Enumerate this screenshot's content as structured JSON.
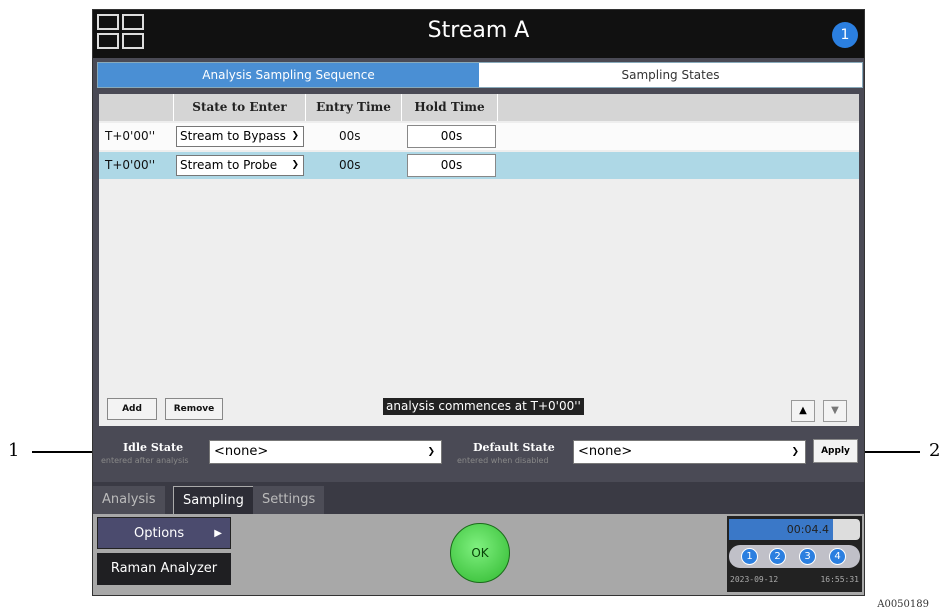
{
  "window": {
    "title": "Stream A",
    "notification_count": "1"
  },
  "top_tabs": [
    "Analysis Sampling Sequence",
    "Sampling States"
  ],
  "table": {
    "headers": [
      "",
      "State to Enter",
      "Entry Time",
      "Hold Time"
    ],
    "rows": [
      {
        "time": "T+0'00''",
        "state": "Stream to Bypass",
        "entry": "00s",
        "hold": "00s"
      },
      {
        "time": "T+0'00''",
        "state": "Stream to Probe",
        "entry": "00s",
        "hold": "00s"
      }
    ]
  },
  "buttons": {
    "add": "Add",
    "remove": "Remove",
    "apply": "Apply",
    "up_arrow": "▲",
    "down_arrow": "▼"
  },
  "commence_text": "analysis commences at T+0'00''",
  "idle": {
    "label": "Idle State",
    "sub": "entered after analysis",
    "value": "<none>"
  },
  "default": {
    "label": "Default State",
    "sub": "entered when disabled",
    "value": "<none>"
  },
  "bottom_tabs": [
    "Analysis",
    "Sampling",
    "Settings"
  ],
  "footer": {
    "options": "Options",
    "raman": "Raman Analyzer",
    "ok": "OK",
    "timer": "00:04.4",
    "streams": [
      "1",
      "2",
      "3",
      "4"
    ],
    "date": "2023-09-12",
    "time": "16:55:31"
  },
  "callouts": [
    "1",
    "2"
  ],
  "figure_id": "A0050189",
  "colors": {
    "accent": "#4a8fd4",
    "selected_row": "#aed8e6",
    "ok_green": "#3fcf3f"
  }
}
